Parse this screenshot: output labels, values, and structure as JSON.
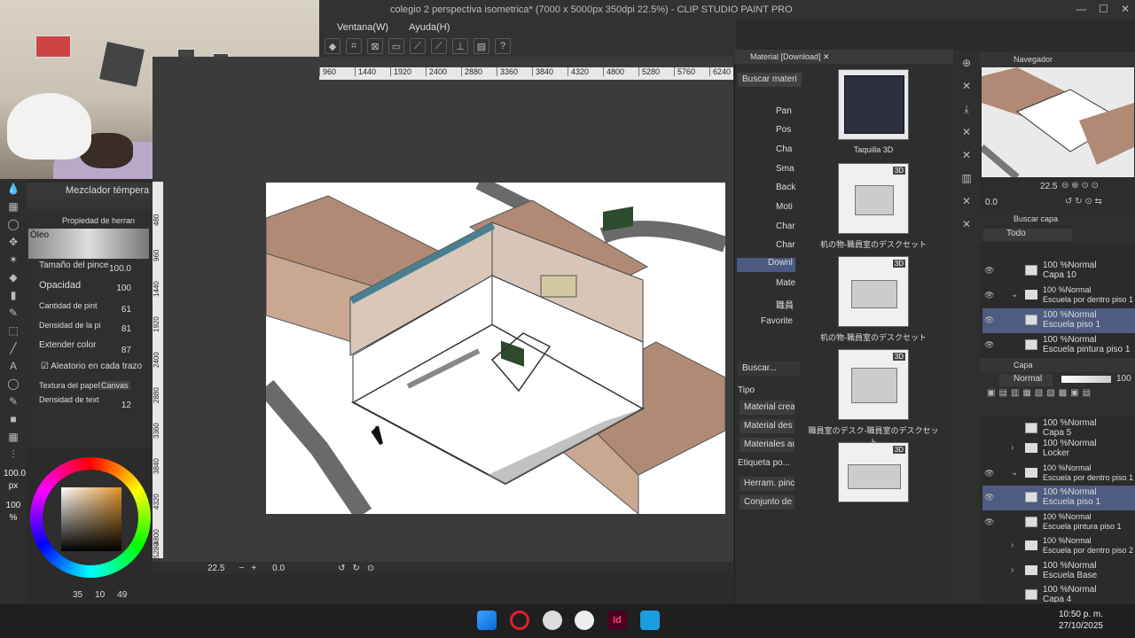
{
  "window": {
    "title": "colegio 2 perspectiva isometrica* (7000 x 5000px 350dpi 22.5%) - CLIP STUDIO PAINT PRO",
    "controls": [
      "—",
      "☐",
      "✕"
    ]
  },
  "menu": [
    "Ventana(W)",
    "Ayuda(H)"
  ],
  "ruler_top": [
    "960",
    "1440",
    "1920",
    "2400",
    "2880",
    "3360",
    "3840",
    "4320",
    "4800",
    "5280",
    "5760",
    "6240",
    "67"
  ],
  "ruler_left": [
    "480",
    "960",
    "1440",
    "1920",
    "2400",
    "2880",
    "3360",
    "3840",
    "4320",
    "4800",
    "5280"
  ],
  "sub_tool": {
    "panel_title": "Mezclador témpera",
    "properties_title": "Propiedad de herran",
    "brush_name": "Óleo",
    "props": [
      {
        "label": "Tamaño del pince",
        "value": "100.0"
      },
      {
        "label": "Opacidad",
        "value": "100"
      },
      {
        "label": "Cantidad de pint",
        "value": "61"
      },
      {
        "label": "Densidad de la pi",
        "value": "81"
      },
      {
        "label": "Extender color",
        "value": "87"
      }
    ],
    "random_label": "Aleatorio en cada trazo",
    "paper_label": "Textura del papel",
    "paper_value": "Canvas",
    "text_density_label": "Densidad de text",
    "text_density_value": "12"
  },
  "brush_size": {
    "value": "100.0",
    "unit": "px"
  },
  "opacity_small": "100 %",
  "bottom_left": {
    "a": "35",
    "b": "10",
    "c": "49"
  },
  "canvas_status": {
    "zoom": "22.5",
    "angle": "0.0"
  },
  "material": {
    "tab_label": "Material [Download]",
    "search_label": "Buscar materi",
    "tree": [
      "Pan",
      "Pos",
      "Cha",
      "Sma",
      "Back",
      "Moti",
      "Char",
      "Char",
      "Downl",
      "Mate",
      "職員",
      "Favorite"
    ],
    "search2": "Buscar...",
    "tipo_label": "Tipo",
    "tipo_buttons": [
      "Material crea",
      "Material des",
      "Materiales ac"
    ],
    "etiqueta_label": "Etiqueta po...",
    "etiqueta_buttons": [
      "Herram. pinc",
      "Conjunto de"
    ],
    "items": [
      {
        "label": "Taquilla 3D",
        "badge": ""
      },
      {
        "label": "机の物-職員室のデスクセット",
        "badge": "3D"
      },
      {
        "label": "机の物-職員室のデスクセット",
        "badge": "3D"
      },
      {
        "label": "職員室のデスク-職員室のデスクセット",
        "badge": "3D"
      },
      {
        "label": "",
        "badge": "3D"
      }
    ]
  },
  "navigator": {
    "title": "Navegador",
    "zoom": "22.5",
    "angle": "0.0"
  },
  "search_layer": {
    "title": "Buscar capa",
    "filter": "Todo"
  },
  "layers_top": [
    {
      "mode": "100 %Normal",
      "name": "Capa 10",
      "type": "layer",
      "selected": false
    },
    {
      "mode": "100 %Normal",
      "name": "Escuela por dentro piso 1",
      "type": "folder",
      "selected": false
    },
    {
      "mode": "100 %Normal",
      "name": "Escuela piso 1",
      "type": "layer",
      "selected": true
    },
    {
      "mode": "100 %Normal",
      "name": "Escuela pintura piso 1",
      "type": "layer",
      "selected": false
    }
  ],
  "layer_panel": {
    "title": "Capa",
    "blend": "Normal",
    "opacity": "100"
  },
  "layers": [
    {
      "mode": "100 %Normal",
      "name": "Capa 5",
      "type": "layer",
      "selected": false
    },
    {
      "mode": "100 %Normal",
      "name": "Locker",
      "type": "folder",
      "selected": false
    },
    {
      "mode": "100 %Normal",
      "name": "Escuela por dentro piso 1",
      "type": "folder",
      "selected": false
    },
    {
      "mode": "100 %Normal",
      "name": "Escuela piso 1",
      "type": "layer",
      "selected": true
    },
    {
      "mode": "100 %Normal",
      "name": "Escuela pintura piso 1",
      "type": "layer",
      "selected": false
    },
    {
      "mode": "100 %Normal",
      "name": "Escuela por dentro piso 2",
      "type": "folder",
      "selected": false
    },
    {
      "mode": "100 %Normal",
      "name": "Escuela Base",
      "type": "folder",
      "selected": false
    },
    {
      "mode": "100 %Normal",
      "name": "Capa 4",
      "type": "layer",
      "selected": false
    }
  ],
  "clock": {
    "time": "10:50 p. m.",
    "date": "27/10/2025"
  },
  "colors": {
    "accent": "#4d5c80",
    "panel": "#2e2e2e",
    "taskbar": "#1f1f1f"
  }
}
